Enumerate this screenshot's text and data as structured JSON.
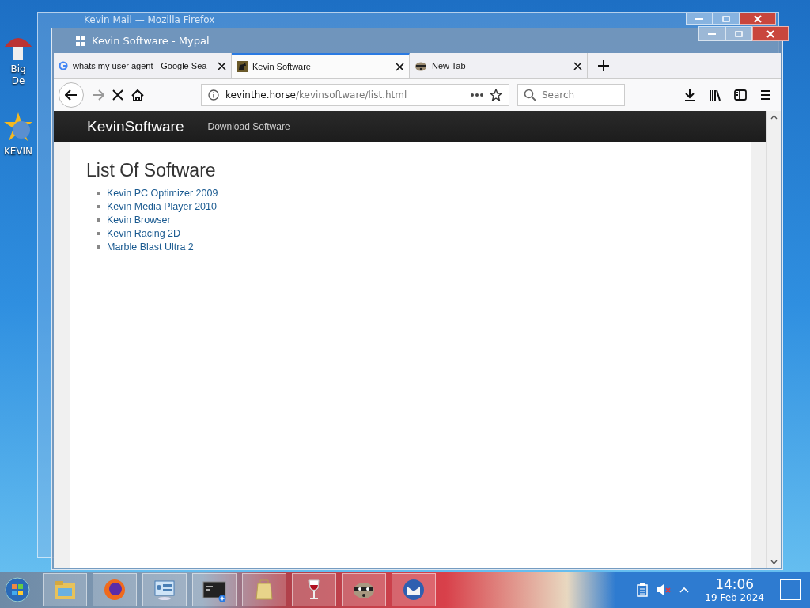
{
  "desktop": {
    "icons": [
      {
        "kind": "mushroom",
        "label_lines": [
          "Big",
          "De"
        ]
      },
      {
        "kind": "sun",
        "label_lines": [
          "KEVIN"
        ]
      }
    ]
  },
  "background_window": {
    "title": "Kevin Mail — Mozilla Firefox"
  },
  "window": {
    "title": "Kevin Software - Mypal",
    "tabs": [
      {
        "label": "whats my user agent - Google Sea",
        "kind": "google",
        "selected": false
      },
      {
        "label": "Kevin Software",
        "kind": "site",
        "selected": true
      },
      {
        "label": "New Tab",
        "kind": "raccoon",
        "selected": false
      }
    ],
    "loading": true,
    "address": {
      "domain": "kevinthe.horse",
      "path": "/kevinsoftware/list.html"
    },
    "search": {
      "placeholder": "Search"
    },
    "page": {
      "brand": "KevinSoftware",
      "nav": [
        "Download Software"
      ],
      "heading": "List Of Software",
      "items": [
        "Kevin PC Optimizer 2009",
        "Kevin Media Player 2010",
        "Kevin Browser",
        "Kevin Racing 2D",
        "Marble Blast Ultra 2"
      ]
    }
  },
  "taskbar": {
    "buttons": [
      {
        "kind": "folder"
      },
      {
        "kind": "firefox"
      },
      {
        "kind": "control-panel"
      },
      {
        "kind": "terminal"
      },
      {
        "kind": "bag"
      },
      {
        "kind": "wine"
      },
      {
        "kind": "raccoon"
      },
      {
        "kind": "mail"
      }
    ],
    "clock": {
      "time": "14:06",
      "date": "19 Feb 2024"
    }
  }
}
